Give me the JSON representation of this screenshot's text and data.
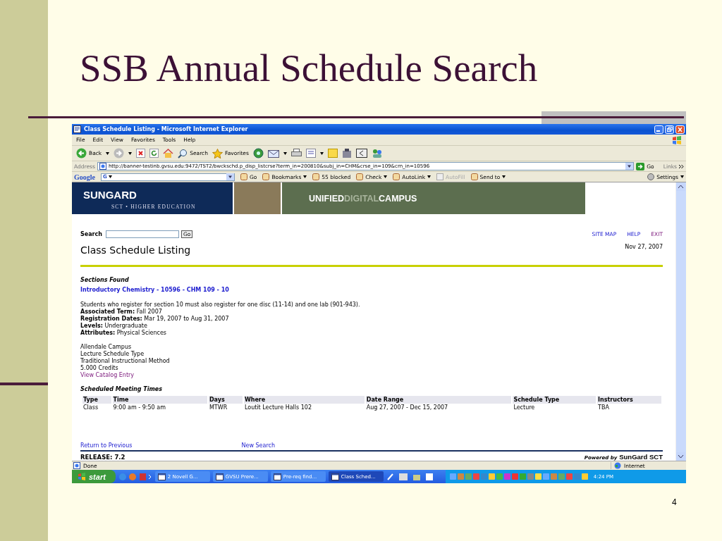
{
  "slide": {
    "title": "SSB Annual Schedule Search",
    "page_number": "4"
  },
  "browser": {
    "title": "Class Schedule Listing - Microsoft Internet Explorer",
    "menu": [
      "File",
      "Edit",
      "View",
      "Favorites",
      "Tools",
      "Help"
    ],
    "toolbar": {
      "back": "Back",
      "search": "Search",
      "favorites": "Favorites"
    },
    "address": {
      "label": "Address",
      "url": "http://banner-testinb.gvsu.edu:9472/TST2/bwckschd.p_disp_listcrse?term_in=200810&subj_in=CHM&crse_in=109&crn_in=10596",
      "go": "Go",
      "links": "Links"
    },
    "google_bar": {
      "logo": "Google",
      "field": "G",
      "buttons": [
        {
          "label": "Go",
          "dropdown": false,
          "disabled": false
        },
        {
          "label": "Bookmarks",
          "dropdown": true,
          "disabled": false
        },
        {
          "label": "55 blocked",
          "dropdown": false,
          "disabled": false
        },
        {
          "label": "Check",
          "dropdown": true,
          "disabled": false
        },
        {
          "label": "AutoLink",
          "dropdown": true,
          "disabled": false
        },
        {
          "label": "AutoFill",
          "dropdown": false,
          "disabled": true
        },
        {
          "label": "Send to",
          "dropdown": true,
          "disabled": false
        }
      ],
      "settings": "Settings"
    },
    "status": {
      "text": "Done",
      "zone": "Internet"
    }
  },
  "page": {
    "banner": {
      "logo": "SUNGARD",
      "tagline": "SCT • HIGHER EDUCATION",
      "product": [
        "UNIFIED",
        "DIGITAL",
        "CAMPUS"
      ]
    },
    "search": {
      "label": "Search",
      "button": "Go"
    },
    "top_links": [
      "SITE MAP",
      "HELP",
      "EXIT"
    ],
    "heading": "Class Schedule Listing",
    "date": "Nov 27, 2007",
    "sections_found": "Sections Found",
    "section_link": "Introductory Chemistry - 10596 - CHM 109 - 10",
    "note": "Students who register for section 10 must also register for one disc (11-14) and one lab (901-943).",
    "fields": [
      "**Associated Term:** Fall 2007",
      "**Registration Dates:** Mar 19, 2007 to Aug 31, 2007",
      "**Levels:** Undergraduate",
      "**Attributes:** Physical Sciences"
    ],
    "info": [
      "Allendale Campus",
      "Lecture Schedule Type",
      "Traditional Instructional Method",
      "5.000 Credits"
    ],
    "catalog_link": "View Catalog Entry",
    "meeting_heading": "Scheduled Meeting Times",
    "table": {
      "columns": [
        "Type",
        "Time",
        "Days",
        "Where",
        "Date Range",
        "Schedule Type",
        "Instructors"
      ],
      "rows": [
        [
          "Class",
          "9:00 am - 9:50 am",
          "MTWR",
          "Loutit Lecture Halls 102",
          "Aug 27, 2007 - Dec 15, 2007",
          "Lecture",
          "TBA"
        ]
      ]
    },
    "footer_links": [
      "Return to Previous",
      "New Search"
    ],
    "release": "RELEASE: 7.2",
    "powered_by": "Powered by",
    "powered_brand": "SunGard SCT"
  },
  "taskbar": {
    "start": "start",
    "buttons": [
      {
        "label": "2 Novell G...",
        "selected": false
      },
      {
        "label": "GVSU Prere...",
        "selected": false
      },
      {
        "label": "Pre-req find...",
        "selected": false
      },
      {
        "label": "Class Sched...",
        "selected": true
      }
    ],
    "clock": "4:24 PM"
  }
}
